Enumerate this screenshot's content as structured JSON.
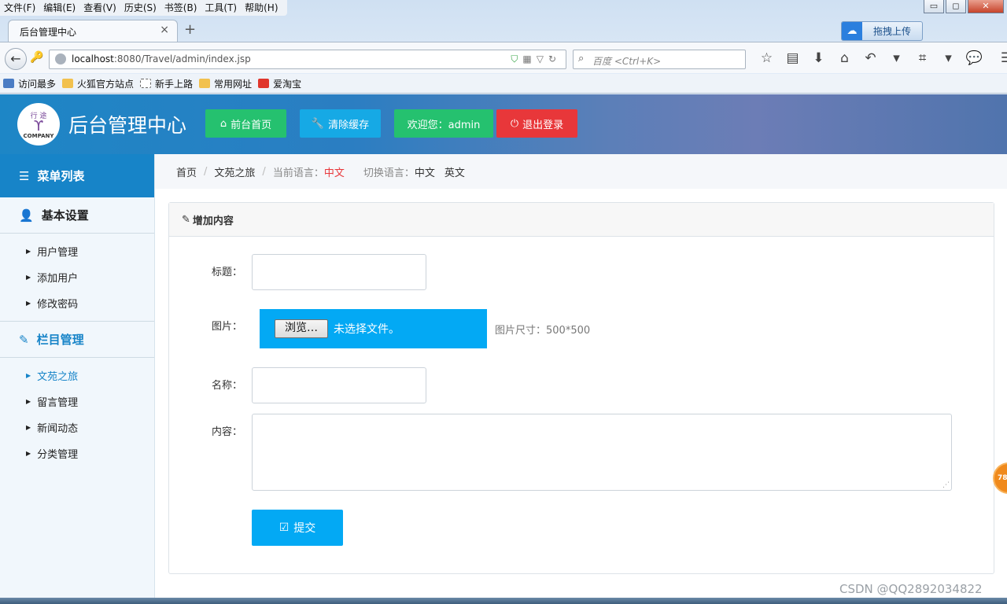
{
  "browser": {
    "menu": [
      "文件(F)",
      "编辑(E)",
      "查看(V)",
      "历史(S)",
      "书签(B)",
      "工具(T)",
      "帮助(H)"
    ],
    "window_controls": {
      "minimize": "▭",
      "maximize": "◻",
      "close": "✕"
    },
    "tab_title": "后台管理中心",
    "tab_close": "×",
    "new_tab": "+",
    "baidu_upload_label": "拖拽上传",
    "url_host": "localhost",
    "url_rest": ":8080/Travel/admin/index.jsp",
    "search_placeholder": "百度 <Ctrl+K>",
    "bookmarks": [
      {
        "label": "访问最多",
        "color": "#4a7cc4"
      },
      {
        "label": "火狐官方站点",
        "color": "#f2c14e"
      },
      {
        "label": "新手上路",
        "color": "#ffffff"
      },
      {
        "label": "常用网址",
        "color": "#f2c14e"
      },
      {
        "label": "爱淘宝",
        "color": "#e0362c"
      }
    ]
  },
  "header": {
    "logo_top": "行 途",
    "logo_bottom": "COMPANY",
    "title": "后台管理中心",
    "buttons": {
      "home": "前台首页",
      "clear_cache": "清除缓存",
      "welcome": "欢迎您：admin",
      "logout": "退出登录"
    }
  },
  "sidebar": {
    "title": "菜单列表",
    "groups": [
      {
        "label": "基本设置",
        "items": [
          "用户管理",
          "添加用户",
          "修改密码"
        ]
      },
      {
        "label": "栏目管理",
        "items": [
          "文苑之旅",
          "留言管理",
          "新闻动态",
          "分类管理"
        ]
      }
    ]
  },
  "breadcrumb": {
    "home": "首页",
    "current": "文苑之旅",
    "lang_label": "当前语言：",
    "lang_value": "中文",
    "switch_label": "切换语言：",
    "switch_cn": "中文",
    "switch_en": "英文"
  },
  "form": {
    "panel_title": "增加内容",
    "title_label": "标题：",
    "image_label": "图片：",
    "browse_button": "浏览…",
    "file_status": "未选择文件。",
    "image_hint": "图片尺寸：500*500",
    "name_label": "名称：",
    "content_label": "内容：",
    "submit": "提交"
  },
  "float_badge": "78",
  "watermark": "CSDN @QQ2892034822",
  "colors": {
    "brand_blue": "#1784c8",
    "green": "#25c16f",
    "cyan": "#16a9e5",
    "red": "#e8373a",
    "submit": "#03a9f4"
  }
}
